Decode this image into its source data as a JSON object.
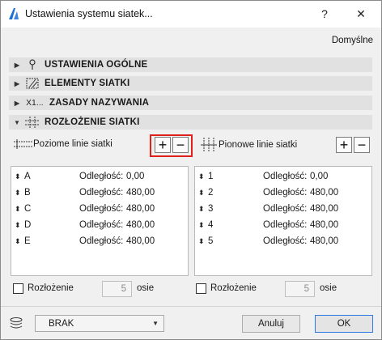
{
  "window": {
    "title": "Ustawienia systemu siatek...",
    "help": "?",
    "close": "✕"
  },
  "defaults_label": "Domyślne",
  "sections": [
    {
      "label": "USTAWIENIA OGÓLNE",
      "icon": "pin-icon",
      "expanded": false
    },
    {
      "label": "ELEMENTY SIATKI",
      "icon": "grid-element-icon",
      "expanded": false
    },
    {
      "label": "ZASADY NAZYWANIA",
      "icon": "naming-icon",
      "icon_text": "X1...",
      "expanded": false
    },
    {
      "label": "ROZŁOŻENIE SIATKI",
      "icon": "grid-layout-icon",
      "expanded": true
    }
  ],
  "horizontal": {
    "label": "Poziome linie siatki",
    "add": "+",
    "remove": "−",
    "rows": [
      {
        "name": "A",
        "dist_label": "Odległość:",
        "dist": "0,00"
      },
      {
        "name": "B",
        "dist_label": "Odległość:",
        "dist": "480,00"
      },
      {
        "name": "C",
        "dist_label": "Odległość:",
        "dist": "480,00"
      },
      {
        "name": "D",
        "dist_label": "Odległość:",
        "dist": "480,00"
      },
      {
        "name": "E",
        "dist_label": "Odległość:",
        "dist": "480,00"
      }
    ],
    "distribution_label": "Rozłożenie",
    "axes_value": "5",
    "axes_label": "osie"
  },
  "vertical": {
    "label": "Pionowe linie siatki",
    "add": "+",
    "remove": "−",
    "rows": [
      {
        "name": "1",
        "dist_label": "Odległość:",
        "dist": "0,00"
      },
      {
        "name": "2",
        "dist_label": "Odległość:",
        "dist": "480,00"
      },
      {
        "name": "3",
        "dist_label": "Odległość:",
        "dist": "480,00"
      },
      {
        "name": "4",
        "dist_label": "Odległość:",
        "dist": "480,00"
      },
      {
        "name": "5",
        "dist_label": "Odległość:",
        "dist": "480,00"
      }
    ],
    "distribution_label": "Rozłożenie",
    "axes_value": "5",
    "axes_label": "osie"
  },
  "footer": {
    "layer_value": "BRAK",
    "cancel": "Anuluj",
    "ok": "OK"
  },
  "colors": {
    "highlight": "#e0211b",
    "ok_border": "#2c7be5"
  }
}
